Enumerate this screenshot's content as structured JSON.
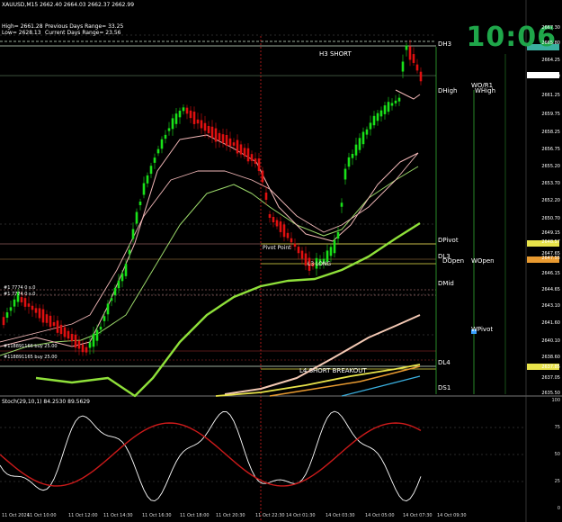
{
  "header": {
    "symbol": "XAUUSD,M15",
    "ohlc": "2662.40 2664.03 2662.37 2662.99",
    "high_line": "High= 2661.28",
    "low_line": "Low= 2628.13",
    "prev_range": "Previous Days Range= 33.25",
    "curr_range": "Current Days Range= 23.56"
  },
  "clock": "10:06",
  "levels": {
    "h3_short": "H3 SHORT",
    "l4_short_breakout": "L4 SHORT BREAKOUT",
    "pivot_point": "Pivot Point",
    "l3_long": "L3 LONG",
    "dh3": "DH3",
    "dhigh": "DHigh",
    "dpivot": "DPivot",
    "dl3": "DL3",
    "dopen": "DOpen",
    "dmid": "DMid",
    "dl4": "DL4",
    "ds1": "DS1",
    "wo_r1": "WO/R1",
    "whigh": "WHigh",
    "wopen": "WOpen",
    "wpivot": "WPivot"
  },
  "order_tags": {
    "buy1": "#118891166 buy 25.00",
    "buy2": "#118891165 buy 25.00",
    "tag1": "#1 7774 0 s.0",
    "tag2": "#1 7774 0 s.0"
  },
  "price_axis": [
    "2667.30",
    "2665.80",
    "2664.25",
    "2662.99",
    "2661.25",
    "2659.75",
    "2658.25",
    "2656.75",
    "2655.20",
    "2653.70",
    "2652.20",
    "2650.70",
    "2649.15",
    "2648.57",
    "2647.65",
    "2647.55",
    "2646.15",
    "2644.65",
    "2643.10",
    "2641.60",
    "2640.10",
    "2638.60",
    "2637.85",
    "2637.05",
    "2635.50"
  ],
  "stoch": {
    "title": "Stoch(29,10,1) 84.2530 89.5629",
    "axis": [
      "100",
      "75",
      "50",
      "25",
      "0"
    ]
  },
  "time_axis": [
    "11 Oct 2024",
    "11 Oct 10:00",
    "11 Oct 12:00",
    "11 Oct 14:30",
    "11 Oct 16:30",
    "11 Oct 18:00",
    "11 Oct 20:30",
    "11 Oct 22:30",
    "14 Oct 01:30",
    "14 Oct 03:30",
    "14 Oct 05:00",
    "14 Oct 07:30",
    "14 Oct 09:30"
  ],
  "colors": {
    "bull": "#19e119",
    "bear": "#e01010",
    "slow_ma": "#8fe03a",
    "mid_ma": "#9bd86a",
    "fast_ma": "#f2b8b8",
    "trend_ma": "#f4c9b4",
    "yellow": "#e8e34a",
    "orange": "#e89a30",
    "clock": "#1fa64a"
  }
}
